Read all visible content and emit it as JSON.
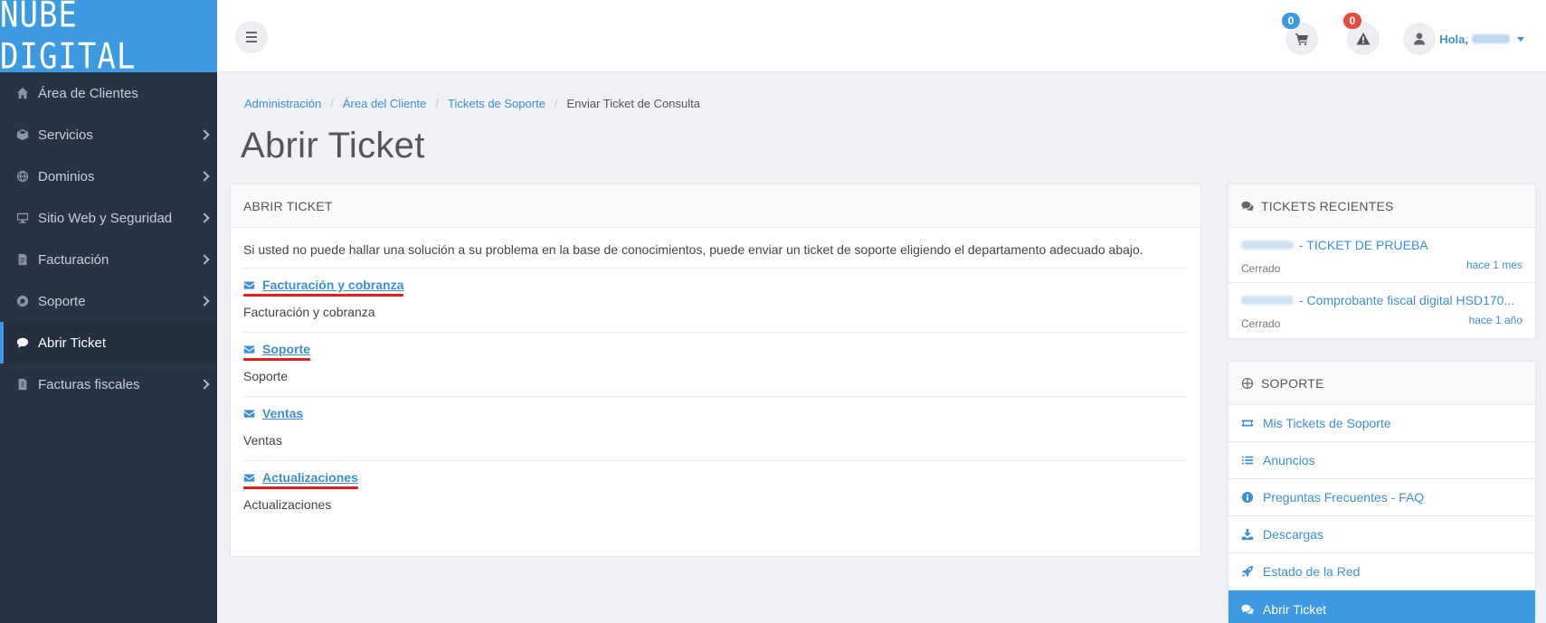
{
  "brand": {
    "logo_text": "NUBE DIGITAL"
  },
  "sidebar": {
    "items": [
      {
        "label": "Área de Clientes",
        "icon": "home-icon",
        "has_submenu": false
      },
      {
        "label": "Servicios",
        "icon": "cube-icon",
        "has_submenu": true
      },
      {
        "label": "Dominios",
        "icon": "globe-icon",
        "has_submenu": true
      },
      {
        "label": "Sitio Web y Seguridad",
        "icon": "monitor-icon",
        "has_submenu": true
      },
      {
        "label": "Facturación",
        "icon": "invoice-icon",
        "has_submenu": true
      },
      {
        "label": "Soporte",
        "icon": "lifebuoy-icon",
        "has_submenu": true
      },
      {
        "label": "Abrir Ticket",
        "icon": "comment-icon",
        "has_submenu": false,
        "active": true
      },
      {
        "label": "Facturas fiscales",
        "icon": "document-icon",
        "has_submenu": true
      }
    ]
  },
  "header": {
    "cart_count": "0",
    "alerts_count": "0",
    "greeting": "Hola,"
  },
  "breadcrumb": {
    "items": [
      "Administración",
      "Área del Cliente",
      "Tickets de Soporte"
    ],
    "current": "Enviar Ticket de Consulta"
  },
  "page": {
    "title": "Abrir Ticket"
  },
  "main_card": {
    "heading": "ABRIR TICKET",
    "intro": "Si usted no puede hallar una solución a su problema en la base de conocimientos, puede enviar un ticket de soporte eligiendo el departamento adecuado abajo.",
    "departments": [
      {
        "title": "Facturación y cobranza",
        "description": "Facturación y cobranza"
      },
      {
        "title": "Soporte",
        "description": "Soporte"
      },
      {
        "title": "Ventas",
        "description": "Ventas"
      },
      {
        "title": "Actualizaciones",
        "description": "Actualizaciones"
      }
    ]
  },
  "recent_tickets": {
    "heading": "TICKETS RECIENTES",
    "items": [
      {
        "subject": "- TICKET DE PRUEBA",
        "status": "Cerrado",
        "time": "hace 1 mes"
      },
      {
        "subject": "- Comprobante fiscal digital HSD170...",
        "status": "Cerrado",
        "time": "hace 1 año"
      }
    ]
  },
  "support_panel": {
    "heading": "SOPORTE",
    "links": [
      {
        "label": "Mis Tickets de Soporte",
        "icon": "ticket-icon"
      },
      {
        "label": "Anuncios",
        "icon": "list-icon"
      },
      {
        "label": "Preguntas Frecuentes - FAQ",
        "icon": "info-icon"
      },
      {
        "label": "Descargas",
        "icon": "download-icon"
      },
      {
        "label": "Estado de la Red",
        "icon": "rocket-icon"
      },
      {
        "label": "Abrir Ticket",
        "icon": "comments-icon",
        "active": true
      }
    ]
  },
  "colors": {
    "brand_blue": "#3d9ae0",
    "sidebar_bg": "#263445",
    "link_blue": "#3d8fd6",
    "badge_red": "#e34b3c",
    "highlight_red": "#e11f1f"
  }
}
